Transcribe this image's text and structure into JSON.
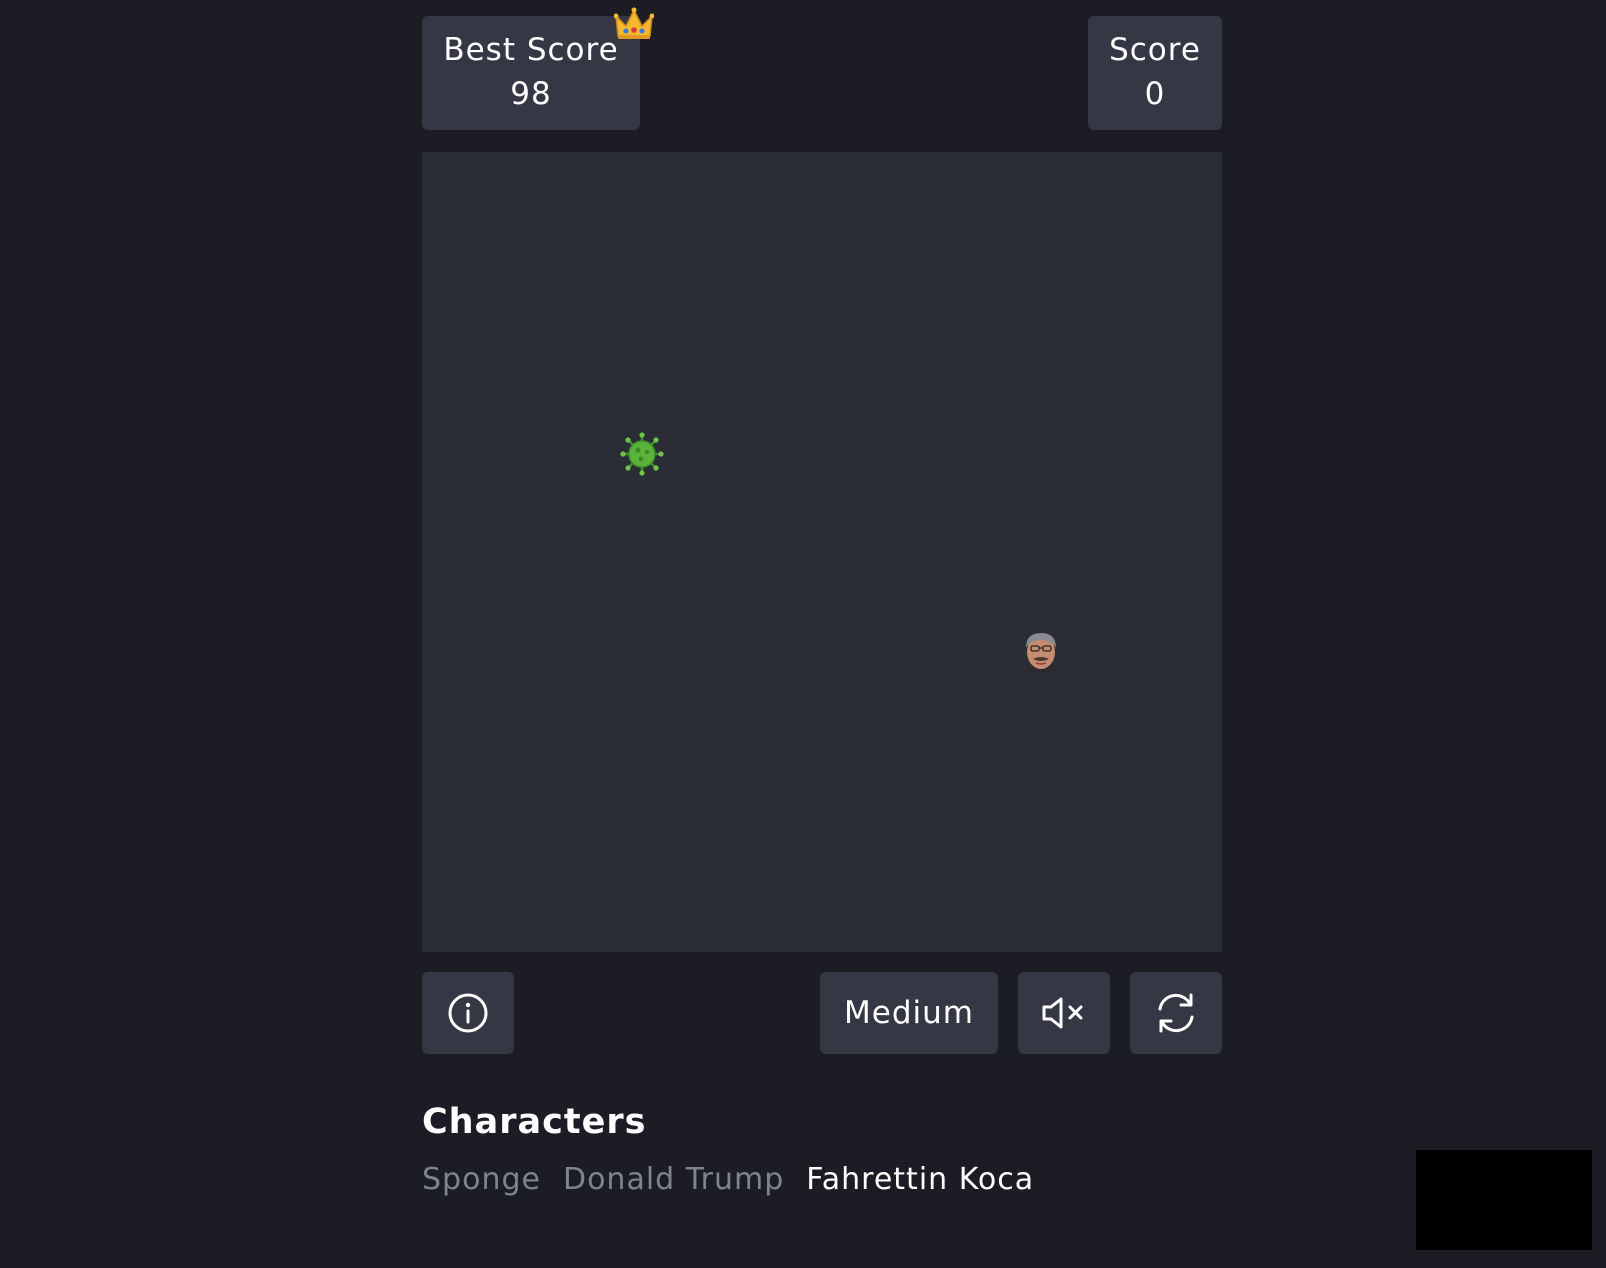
{
  "best_score": {
    "label": "Best Score",
    "value": "98",
    "icon": "crown-icon"
  },
  "score": {
    "label": "Score",
    "value": "0"
  },
  "board": {
    "items": [
      {
        "name": "virus",
        "icon": "virus-icon",
        "color": "#5bb33c"
      },
      {
        "name": "snake-head",
        "icon": "face-icon"
      }
    ]
  },
  "controls": {
    "info_icon": "info-icon",
    "difficulty_label": "Medium",
    "mute_icon": "speaker-muted-icon",
    "restart_icon": "refresh-icon"
  },
  "characters": {
    "title": "Characters",
    "items": [
      "Sponge",
      "Donald Trump",
      "Fahrettin Koca"
    ],
    "selected": "Fahrettin Koca"
  },
  "colors": {
    "background": "#1c1d24",
    "panel": "#353844",
    "board": "#2a2c36",
    "text": "#ffffff",
    "text_muted": "#7e8291"
  }
}
